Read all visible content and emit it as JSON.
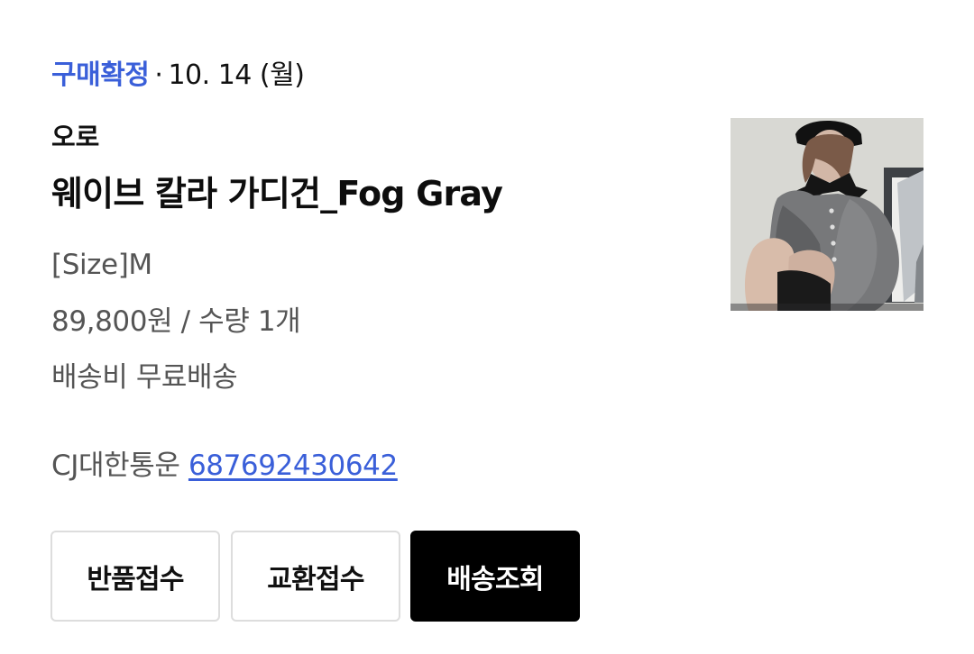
{
  "order": {
    "status": "구매확정",
    "separator": "·",
    "date": "10. 14 (월)"
  },
  "product": {
    "brand": "오로",
    "name": "웨이브 칼라 가디건_Fog Gray",
    "option": "[Size]M",
    "price_quantity": "89,800원 / 수량 1개",
    "shipping": "배송비 무료배송",
    "thumbnail_alt": "product-photo"
  },
  "delivery": {
    "carrier": "CJ대한통운",
    "tracking_number": "687692430642"
  },
  "actions": {
    "return_label": "반품접수",
    "exchange_label": "교환접수",
    "tracking_label": "배송조회"
  },
  "colors": {
    "accent": "#3a5fd9",
    "text_primary": "#111111",
    "text_secondary": "#555555",
    "border": "#dddddd",
    "button_dark": "#000000"
  }
}
